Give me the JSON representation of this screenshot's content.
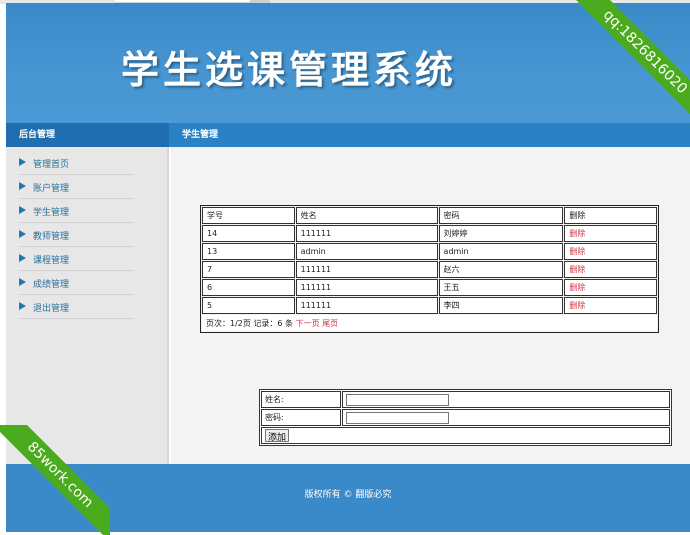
{
  "header": {
    "site_title": "学生选课管理系统"
  },
  "nav": {
    "left_title": "后台管理",
    "section_title": "学生管理"
  },
  "sidebar": {
    "items": [
      {
        "label": "管理首页"
      },
      {
        "label": "账户管理"
      },
      {
        "label": "学生管理"
      },
      {
        "label": "教师管理"
      },
      {
        "label": "课程管理"
      },
      {
        "label": "成绩管理"
      },
      {
        "label": "退出管理"
      }
    ]
  },
  "student_table": {
    "headers": [
      "学号",
      "姓名",
      "密码",
      "删除"
    ],
    "rows": [
      {
        "id": "14",
        "name": "111111",
        "password": "刘婷婷",
        "action": "删除"
      },
      {
        "id": "13",
        "name": "admin",
        "password": "admin",
        "action": "删除"
      },
      {
        "id": "7",
        "name": "111111",
        "password": "赵六",
        "action": "删除"
      },
      {
        "id": "6",
        "name": "111111",
        "password": "王五",
        "action": "删除"
      },
      {
        "id": "5",
        "name": "111111",
        "password": "李四",
        "action": "删除"
      }
    ],
    "pager": {
      "info": "页次：1/2页 记录：6 条",
      "next": "下一页",
      "last": "尾页"
    }
  },
  "add_form": {
    "name_label": "姓名:",
    "name_value": "",
    "password_label": "密码:",
    "password_value": "",
    "submit_label": "添加"
  },
  "footer": {
    "text": "版权所有 © 翻版必究"
  },
  "watermarks": {
    "top_right": "qq:1826816020",
    "bottom_left": "85work.com"
  },
  "colors": {
    "header_blue": "#3a8ac9",
    "nav_blue": "#2a82c4",
    "delete_red": "#d2334a",
    "ribbon_green": "#4bab1f"
  }
}
